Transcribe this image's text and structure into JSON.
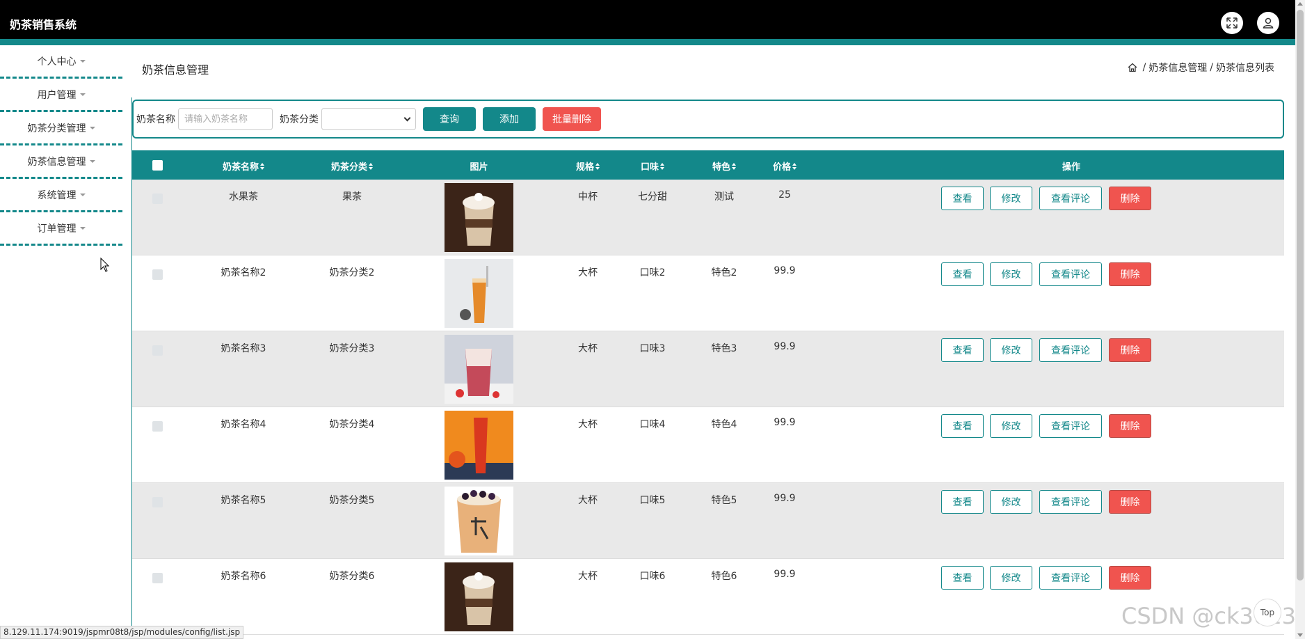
{
  "app": {
    "title": "奶茶销售系统"
  },
  "sidebar": {
    "items": [
      {
        "label": "个人中心"
      },
      {
        "label": "用户管理"
      },
      {
        "label": "奶茶分类管理"
      },
      {
        "label": "奶茶信息管理"
      },
      {
        "label": "系统管理"
      },
      {
        "label": "订单管理"
      }
    ]
  },
  "page": {
    "title": "奶茶信息管理"
  },
  "breadcrumb": {
    "items": [
      "奶茶信息管理",
      "奶茶信息列表"
    ],
    "separator": "/"
  },
  "search": {
    "name_label": "奶茶名称",
    "name_placeholder": "请输入奶茶名称",
    "category_label": "奶茶分类",
    "category_value": "",
    "query_label": "查询",
    "add_label": "添加",
    "batch_delete_label": "批量删除"
  },
  "table": {
    "columns": [
      "奶茶名称",
      "奶茶分类",
      "图片",
      "规格",
      "口味",
      "特色",
      "价格",
      "操作"
    ],
    "rows": [
      {
        "name": "水果茶",
        "category": "果茶",
        "spec": "中杯",
        "taste": "七分甜",
        "feature": "测试",
        "price": "25",
        "image": "cream-tea-icon"
      },
      {
        "name": "奶茶名称2",
        "category": "奶茶分类2",
        "spec": "大杯",
        "taste": "口味2",
        "feature": "特色2",
        "price": "99.9",
        "image": "orange-tea-icon"
      },
      {
        "name": "奶茶名称3",
        "category": "奶茶分类3",
        "spec": "大杯",
        "taste": "口味3",
        "feature": "特色3",
        "price": "99.9",
        "image": "strawberry-tea-icon"
      },
      {
        "name": "奶茶名称4",
        "category": "奶茶分类4",
        "spec": "大杯",
        "taste": "口味4",
        "feature": "特色4",
        "price": "99.9",
        "image": "red-tea-icon"
      },
      {
        "name": "奶茶名称5",
        "category": "奶茶分类5",
        "spec": "大杯",
        "taste": "口味5",
        "feature": "特色5",
        "price": "99.9",
        "image": "boba-tea-icon"
      },
      {
        "name": "奶茶名称6",
        "category": "奶茶分类6",
        "spec": "大杯",
        "taste": "口味6",
        "feature": "特色6",
        "price": "99.9",
        "image": "cream-tea-icon"
      }
    ],
    "actions": {
      "view": "查看",
      "edit": "修改",
      "view_comments": "查看评论",
      "delete": "删除"
    }
  },
  "status": {
    "url": "8.129.11.174:9019/jspmr08t8/jsp/modules/config/list.jsp"
  },
  "watermark": "CSDN @ck3013",
  "top_button": "Top",
  "colors": {
    "primary": "#13888a",
    "danger": "#f0544f",
    "topbar": "#000000"
  }
}
